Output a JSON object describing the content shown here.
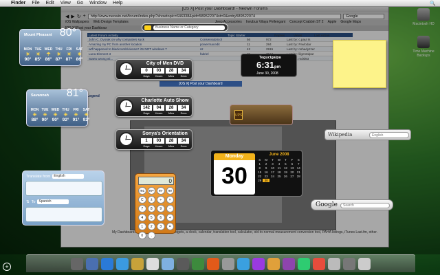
{
  "menubar": {
    "app": "Finder",
    "items": [
      "File",
      "Edit",
      "View",
      "Go",
      "Window",
      "Help"
    ]
  },
  "browser": {
    "title": "[OS X] Post your Dashboard! - Neowin Forums",
    "url": "http://www.neowin.net/forum/index.php?showtopic=646338&pid=589522074st=0&entry589522074",
    "search_placeholder": "Google",
    "bookmarks": [
      "iOS Wallpapers",
      "Web Design Templates",
      "Jeep Accessories",
      "Invubus Vilaya Pellengant",
      "Concept Crabbin ST 2",
      "Apple",
      "Google Maps"
    ],
    "tab": "[OS X] Post your Dashboar"
  },
  "forum": {
    "headers": [
      "Latest Forum Activity",
      "Topic Starter",
      "Replies",
      "Views",
      "Last Action"
    ],
    "rows": [
      [
        "John C. Dvorak on why computers suck",
        "Conservatoricol",
        "56",
        "972",
        "Last by: c.paul Is"
      ],
      [
        "Amazing my PC from another location",
        "powermacedit",
        "11",
        "284",
        "Last by: Pavlodar"
      ],
      [
        "wtf happened to blackcomb/vienna? it's NOT windows 7",
        "sz",
        "42",
        "2915",
        "Last by: nshadyzzer"
      ],
      [
        "Luna Element 3",
        "fabriel",
        "25",
        "7513",
        "Last by: lilgentalpar"
      ],
      [
        "Starts wrong wi...",
        "",
        "",
        "",
        "Last by: mdsl93"
      ]
    ],
    "post_bar": "[OS X] Post your Dashboard",
    "legend": "Legend",
    "body": "My Dashboard... the widgets are under widgets, a clock, calendar, translation tool, calculator, old-to-normal measurement conversion tool, PAHA listings, iTunes Last.fm, other."
  },
  "search_widget": {
    "placeholder": "Business Name or Category"
  },
  "weather1": {
    "location": "Mount Pleasant",
    "temp": "80°",
    "days": [
      "MON",
      "TUE",
      "WED",
      "THU",
      "FRI",
      "SAT"
    ],
    "highs": [
      "90°",
      "85°",
      "86°",
      "87°",
      "87°",
      "86°"
    ]
  },
  "weather2": {
    "location": "Savannah",
    "temp": "81°",
    "days": [
      "MON",
      "TUE",
      "WED",
      "THU",
      "FRI",
      "SAT"
    ],
    "highs": [
      "88°",
      "90°",
      "90°",
      "92°",
      "91°",
      "92°"
    ]
  },
  "countdowns": [
    {
      "title": "City of Men DVD",
      "nums": [
        "0",
        "03",
        "28",
        "34"
      ],
      "labels": [
        "Days",
        "Hours",
        "Mins",
        "Secs"
      ]
    },
    {
      "title": "Charlotte Auto Show",
      "nums": [
        "142",
        "04",
        "28",
        "34"
      ],
      "labels": [
        "Days",
        "Hours",
        "Mins",
        "Secs"
      ]
    },
    {
      "title": "Sonya's Orientation",
      "nums": [
        "1",
        "03",
        "28",
        "34"
      ],
      "labels": [
        "Days",
        "Hours",
        "Mins",
        "Secs"
      ]
    }
  ],
  "world_clock": {
    "city": "Tegucigalpa",
    "time": "6:31",
    "ampm": "pm",
    "date": "June 30, 2008"
  },
  "calendar": {
    "weekday": "Monday",
    "day": "30",
    "month": "June 2008",
    "grid": [
      "S",
      "M",
      "T",
      "W",
      "T",
      "F",
      "S",
      "1",
      "2",
      "3",
      "4",
      "5",
      "6",
      "7",
      "8",
      "9",
      "10",
      "11",
      "12",
      "13",
      "14",
      "15",
      "16",
      "17",
      "18",
      "19",
      "20",
      "21",
      "22",
      "23",
      "24",
      "25",
      "26",
      "27",
      "28",
      "29",
      "30",
      "",
      "",
      "",
      "",
      ""
    ]
  },
  "wikipedia": {
    "label": "Wikipedia",
    "placeholder": "English"
  },
  "google": {
    "label": "Google",
    "placeholder": "Search"
  },
  "translate": {
    "from_label": "Translate from",
    "from": "English",
    "to_label": "To",
    "to": "Spanish"
  },
  "calculator": {
    "display": "0",
    "keys": [
      "mc",
      "m+",
      "m-",
      "mr",
      "C",
      "±",
      "÷",
      "×",
      "7",
      "8",
      "9",
      "-",
      "4",
      "5",
      "6",
      "+",
      "1",
      "2",
      "3",
      "=",
      "0",
      ".",
      "",
      ""
    ]
  },
  "desktop": {
    "icons": [
      "Macintosh HD",
      "Time Machine Backups"
    ]
  }
}
